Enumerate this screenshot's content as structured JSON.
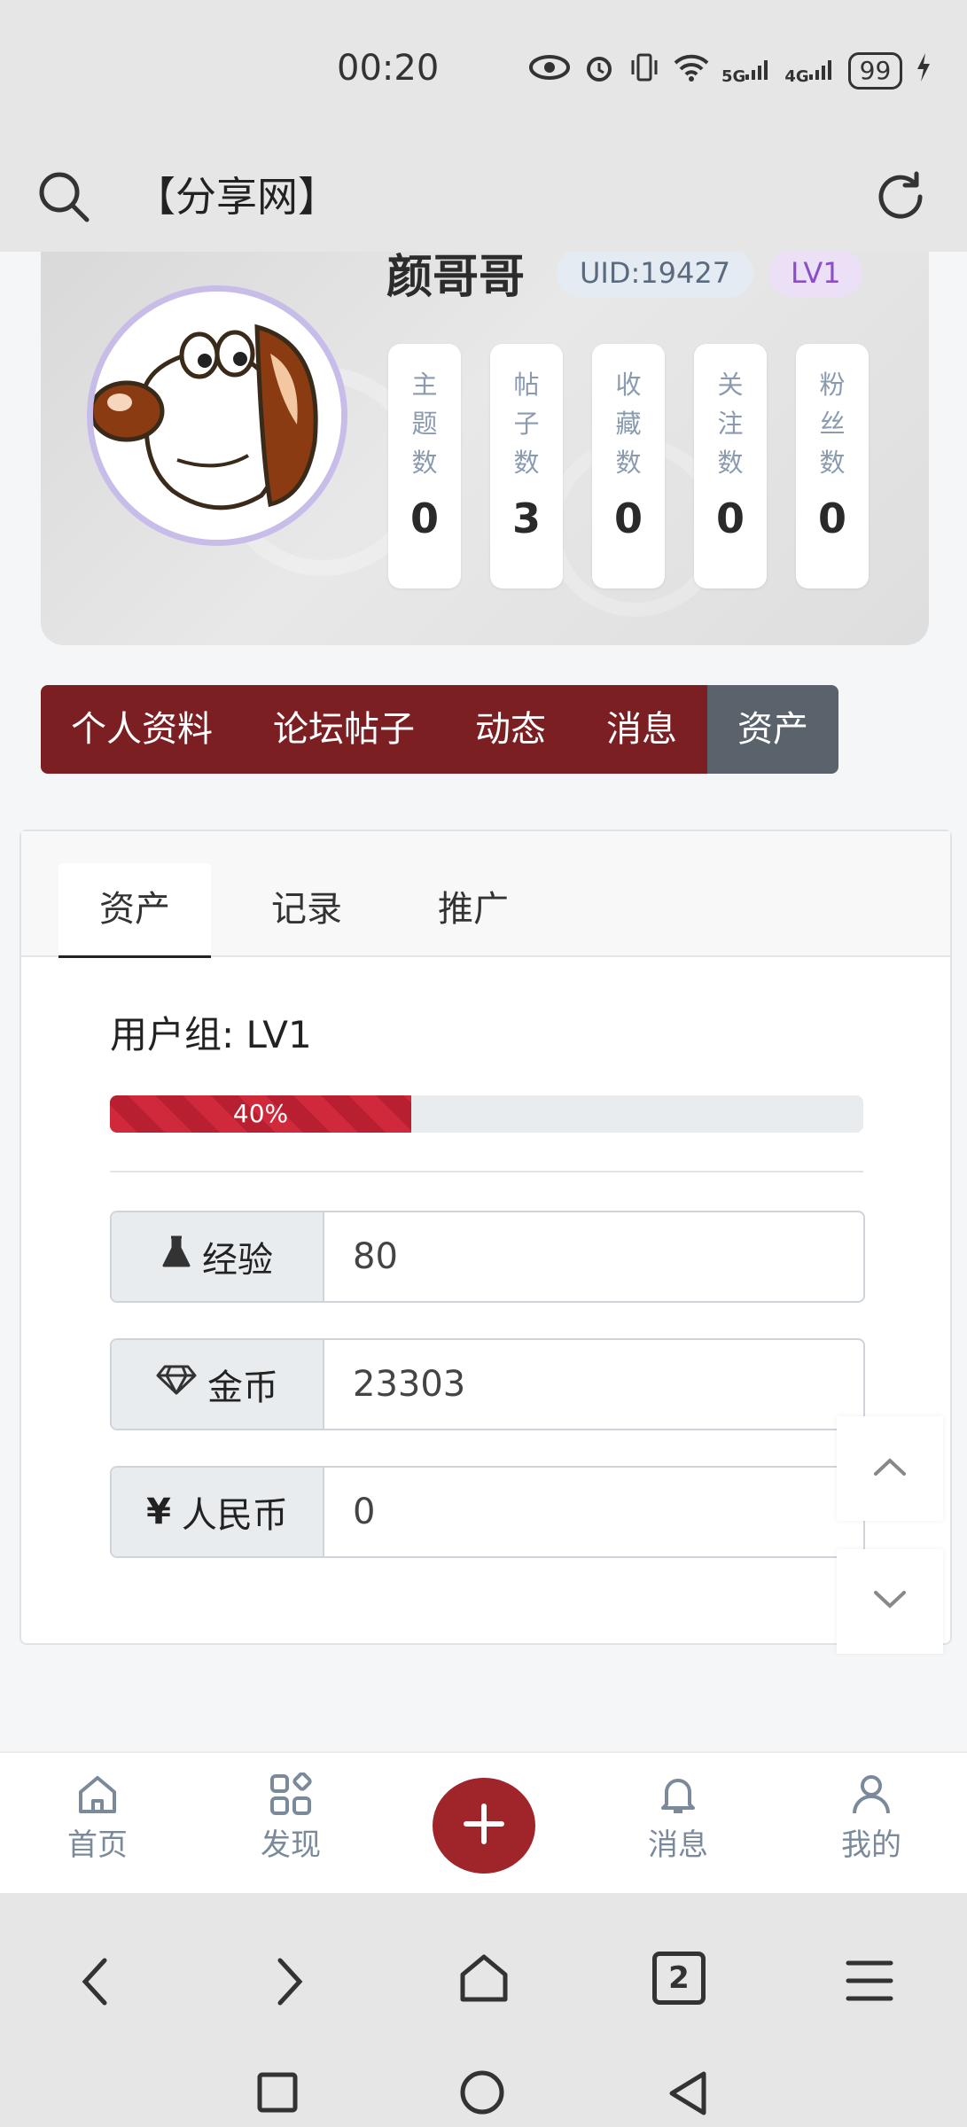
{
  "status_bar": {
    "time": "00:20",
    "signal_1": "5G",
    "signal_2": "4G",
    "battery": "99"
  },
  "app_bar": {
    "title": "【分享网】",
    "icons": [
      "search-icon",
      "refresh-icon"
    ]
  },
  "profile": {
    "username": "颜哥哥",
    "uid": "UID:19427",
    "level": "LV1",
    "stats": [
      {
        "label": "主题数",
        "value": "0"
      },
      {
        "label": "帖子数",
        "value": "3"
      },
      {
        "label": "收藏数",
        "value": "0"
      },
      {
        "label": "关注数",
        "value": "0"
      },
      {
        "label": "粉丝数",
        "value": "0"
      }
    ]
  },
  "nav_tabs": [
    {
      "label": "个人资料",
      "active": false
    },
    {
      "label": "论坛帖子",
      "active": false
    },
    {
      "label": "动态",
      "active": false
    },
    {
      "label": "消息",
      "active": false
    },
    {
      "label": "资产",
      "active": true
    }
  ],
  "asset_panel": {
    "tabs": [
      {
        "label": "资产",
        "active": true
      },
      {
        "label": "记录",
        "active": false
      },
      {
        "label": "推广",
        "active": false
      }
    ],
    "user_group": "用户组: LV1",
    "progress": {
      "percent": 40,
      "label": "40%"
    },
    "fields": [
      {
        "icon": "flask-icon",
        "label": "经验",
        "value": "80"
      },
      {
        "icon": "diamond-icon",
        "label": "金币",
        "value": "23303"
      },
      {
        "icon": "yen-icon",
        "label": "人民币",
        "value": "0",
        "icon_glyph": "¥"
      }
    ]
  },
  "scroll_buttons": [
    "scroll-up-icon",
    "scroll-down-icon"
  ],
  "bottom_nav": [
    {
      "label": "首页",
      "icon": "home-icon"
    },
    {
      "label": "发现",
      "icon": "grid-icon"
    },
    {
      "label": "",
      "icon": "plus-icon"
    },
    {
      "label": "消息",
      "icon": "bell-icon"
    },
    {
      "label": "我的",
      "icon": "user-icon"
    }
  ],
  "browser_tabs_count": "2",
  "colors": {
    "primary": "#7c1f22",
    "active_tab": "#5a626b",
    "progress": "#d0293c",
    "fab": "#a0252b"
  }
}
